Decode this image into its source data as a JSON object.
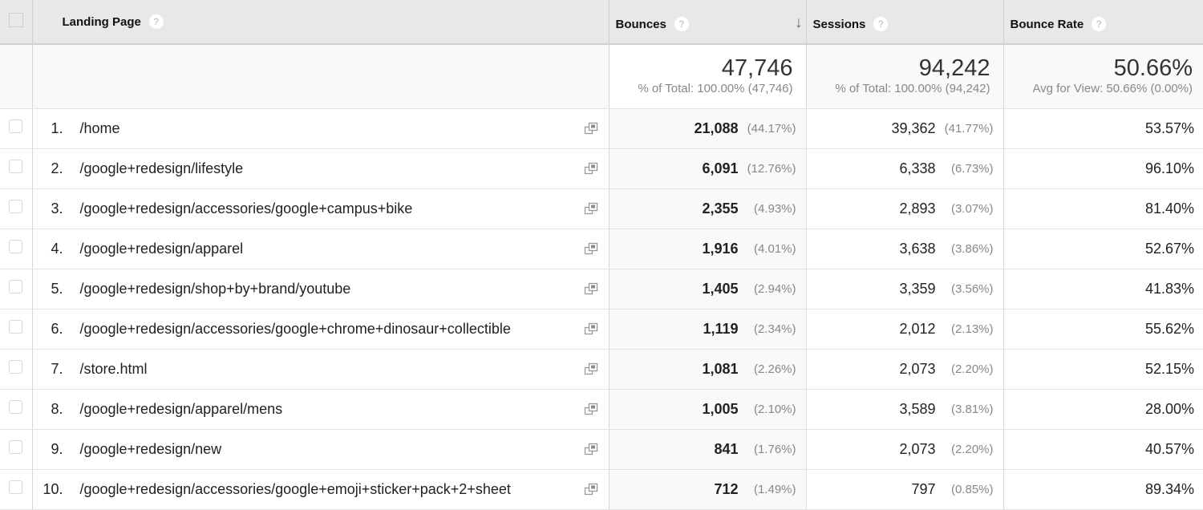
{
  "table": {
    "headers": {
      "landing_page": "Landing Page",
      "bounces": "Bounces",
      "sessions": "Sessions",
      "bounce_rate": "Bounce Rate",
      "help_icon": "?",
      "sort_icon": "↓"
    },
    "totals": {
      "bounces": {
        "value": "47,746",
        "sub": "% of Total: 100.00% (47,746)"
      },
      "sessions": {
        "value": "94,242",
        "sub": "% of Total: 100.00% (94,242)"
      },
      "bounce_rate": {
        "value": "50.66%",
        "sub": "Avg for View: 50.66% (0.00%)"
      }
    },
    "rows": [
      {
        "rank": "1.",
        "page": "/home",
        "bounces": "21,088",
        "bounces_pct": "(44.17%)",
        "sessions": "39,362",
        "sessions_pct": "(41.77%)",
        "bounce_rate": "53.57%"
      },
      {
        "rank": "2.",
        "page": "/google+redesign/lifestyle",
        "bounces": "6,091",
        "bounces_pct": "(12.76%)",
        "sessions": "6,338",
        "sessions_pct": "(6.73%)",
        "bounce_rate": "96.10%"
      },
      {
        "rank": "3.",
        "page": "/google+redesign/accessories/google+campus+bike",
        "bounces": "2,355",
        "bounces_pct": "(4.93%)",
        "sessions": "2,893",
        "sessions_pct": "(3.07%)",
        "bounce_rate": "81.40%"
      },
      {
        "rank": "4.",
        "page": "/google+redesign/apparel",
        "bounces": "1,916",
        "bounces_pct": "(4.01%)",
        "sessions": "3,638",
        "sessions_pct": "(3.86%)",
        "bounce_rate": "52.67%"
      },
      {
        "rank": "5.",
        "page": "/google+redesign/shop+by+brand/youtube",
        "bounces": "1,405",
        "bounces_pct": "(2.94%)",
        "sessions": "3,359",
        "sessions_pct": "(3.56%)",
        "bounce_rate": "41.83%"
      },
      {
        "rank": "6.",
        "page": "/google+redesign/accessories/google+chrome+dinosaur+collectible",
        "bounces": "1,119",
        "bounces_pct": "(2.34%)",
        "sessions": "2,012",
        "sessions_pct": "(2.13%)",
        "bounce_rate": "55.62%"
      },
      {
        "rank": "7.",
        "page": "/store.html",
        "bounces": "1,081",
        "bounces_pct": "(2.26%)",
        "sessions": "2,073",
        "sessions_pct": "(2.20%)",
        "bounce_rate": "52.15%"
      },
      {
        "rank": "8.",
        "page": "/google+redesign/apparel/mens",
        "bounces": "1,005",
        "bounces_pct": "(2.10%)",
        "sessions": "3,589",
        "sessions_pct": "(3.81%)",
        "bounce_rate": "28.00%"
      },
      {
        "rank": "9.",
        "page": "/google+redesign/new",
        "bounces": "841",
        "bounces_pct": "(1.76%)",
        "sessions": "2,073",
        "sessions_pct": "(2.20%)",
        "bounce_rate": "40.57%"
      },
      {
        "rank": "10.",
        "page": "/google+redesign/accessories/google+emoji+sticker+pack+2+sheet",
        "bounces": "712",
        "bounces_pct": "(1.49%)",
        "sessions": "797",
        "sessions_pct": "(0.85%)",
        "bounce_rate": "89.34%"
      }
    ]
  }
}
